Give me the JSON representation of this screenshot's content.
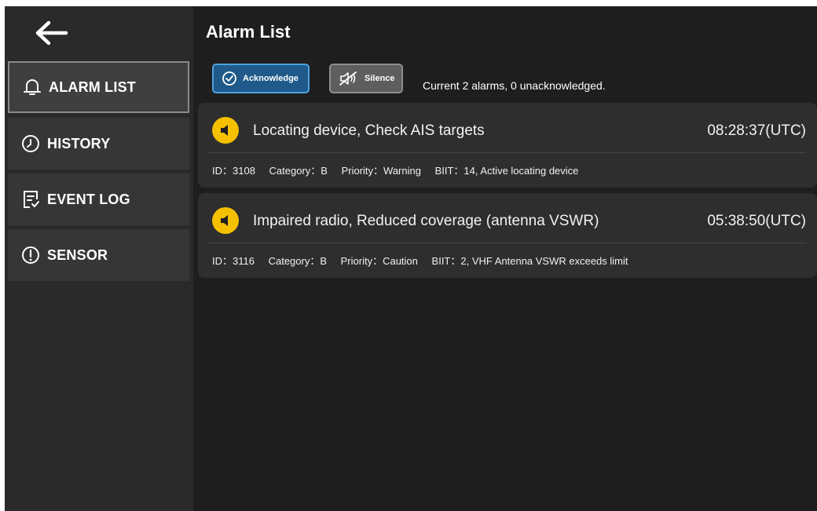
{
  "sidebar": {
    "back_icon": "arrow-left-icon",
    "items": [
      {
        "label": "ALARM LIST",
        "icon": "bell-icon",
        "active": true
      },
      {
        "label": "HISTORY",
        "icon": "clock-icon",
        "active": false
      },
      {
        "label": "EVENT LOG",
        "icon": "document-check-icon",
        "active": false
      },
      {
        "label": "SENSOR",
        "icon": "exclamation-circle-icon",
        "active": false
      }
    ]
  },
  "header": {
    "title": "Alarm List"
  },
  "toolbar": {
    "acknowledge_label": "Acknowledge",
    "silence_label": "Silence",
    "status_text": "Current 2 alarms, 0 unacknowledged."
  },
  "alarms": [
    {
      "title": "Locating device, Check AIS targets",
      "time": "08:28:37(UTC)",
      "id": "ID：3108",
      "category": "Category：B",
      "priority": "Priority：Warning",
      "biit": "BIIT：14, Active locating device",
      "severity_icon": "speaker-icon",
      "severity_color": "#f5c000"
    },
    {
      "title": "Impaired radio, Reduced coverage (antenna VSWR)",
      "time": "05:38:50(UTC)",
      "id": "ID：3116",
      "category": "Category：B",
      "priority": "Priority：Caution",
      "biit": "BIIT：2, VHF Antenna VSWR exceeds limit",
      "severity_icon": "speaker-icon",
      "severity_color": "#f5c000"
    }
  ],
  "colors": {
    "background": "#1e1e1e",
    "sidebar": "#2a2a2a",
    "accent": "#4ea3e0",
    "warning": "#f5c000"
  }
}
